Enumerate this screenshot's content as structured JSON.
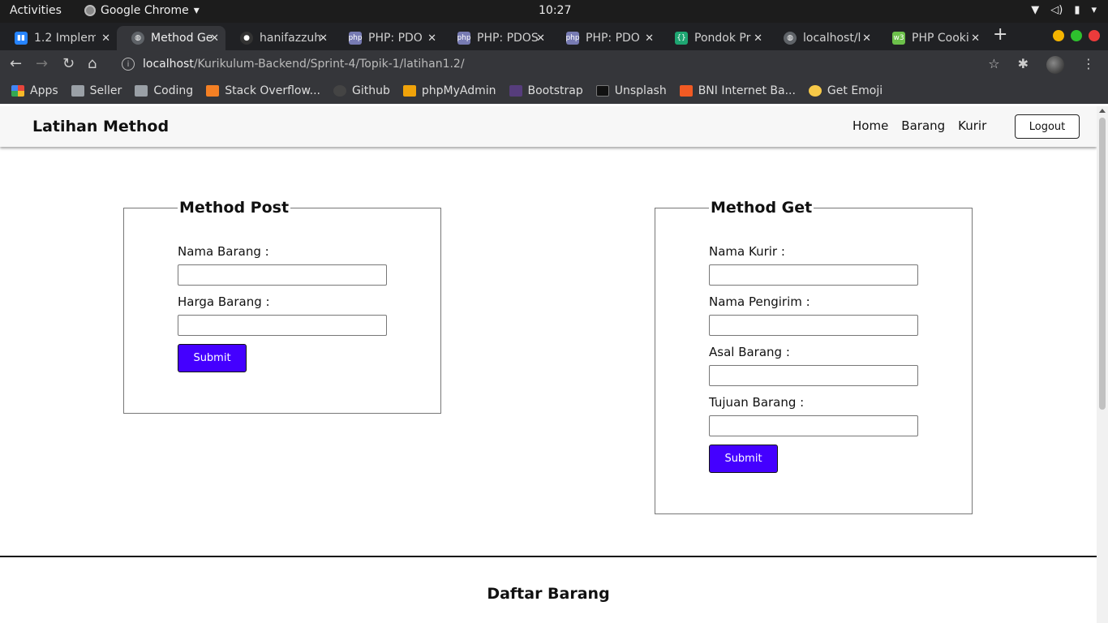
{
  "os": {
    "activities": "Activities",
    "app_name": "Google Chrome",
    "clock": "10:27"
  },
  "tabs": [
    {
      "label": "1.2 Implem",
      "icon": "trello-icon",
      "color": "#2684ff",
      "glyph": "▮▮"
    },
    {
      "label": "Method Ge",
      "icon": "globe-icon",
      "color": "#5f6368",
      "glyph": "◍"
    },
    {
      "label": "hanifazzuh",
      "icon": "github-icon",
      "color": "#333333",
      "glyph": "●"
    },
    {
      "label": "PHP: PDO",
      "icon": "php-icon",
      "color": "#777bb3",
      "glyph": "php"
    },
    {
      "label": "PHP: PDOS",
      "icon": "php-icon",
      "color": "#777bb3",
      "glyph": "php"
    },
    {
      "label": "PHP: PDO",
      "icon": "php-icon",
      "color": "#777bb3",
      "glyph": "php"
    },
    {
      "label": "Pondok Pr",
      "icon": "code-icon",
      "color": "#1ea672",
      "glyph": "{}"
    },
    {
      "label": "localhost/l",
      "icon": "globe-icon",
      "color": "#5f6368",
      "glyph": "◍"
    },
    {
      "label": "PHP Cooki",
      "icon": "w3c-icon",
      "color": "#6cc04a",
      "glyph": "w3"
    }
  ],
  "address_bar": {
    "host": "localhost",
    "path": "/Kurikulum-Backend/Sprint-4/Topik-1/latihan1.2/"
  },
  "bookmarks": [
    {
      "label": "Apps",
      "icon": "apps-grid-icon",
      "color": "#e8453c"
    },
    {
      "label": "Seller",
      "icon": "folder-icon",
      "color": "#9aa0a6"
    },
    {
      "label": "Coding",
      "icon": "folder-icon",
      "color": "#9aa0a6"
    },
    {
      "label": "Stack Overflow...",
      "icon": "stackoverflow-icon",
      "color": "#f48024"
    },
    {
      "label": "Github",
      "icon": "github-icon",
      "color": "#444444"
    },
    {
      "label": "phpMyAdmin",
      "icon": "phpmyadmin-icon",
      "color": "#f0a30a"
    },
    {
      "label": "Bootstrap",
      "icon": "bootstrap-icon",
      "color": "#563d7c"
    },
    {
      "label": "Unsplash",
      "icon": "unsplash-icon",
      "color": "#111111"
    },
    {
      "label": "BNI Internet Ba...",
      "icon": "bni-icon",
      "color": "#f15a23"
    },
    {
      "label": "Get Emoji",
      "icon": "emoji-icon",
      "color": "#f7c948"
    }
  ],
  "site": {
    "brand": "Latihan Method",
    "nav": [
      "Home",
      "Barang",
      "Kurir"
    ],
    "logout": "Logout",
    "post_form": {
      "legend": "Method Post",
      "fields": [
        {
          "label": "Nama Barang :",
          "value": ""
        },
        {
          "label": "Harga Barang :",
          "value": ""
        }
      ],
      "submit": "Submit"
    },
    "get_form": {
      "legend": "Method Get",
      "fields": [
        {
          "label": "Nama Kurir :",
          "value": ""
        },
        {
          "label": "Nama Pengirim :",
          "value": ""
        },
        {
          "label": "Asal Barang :",
          "value": ""
        },
        {
          "label": "Tujuan Barang :",
          "value": ""
        }
      ],
      "submit": "Submit"
    },
    "section_title": "Daftar Barang",
    "accent_color": "#4400ff"
  }
}
